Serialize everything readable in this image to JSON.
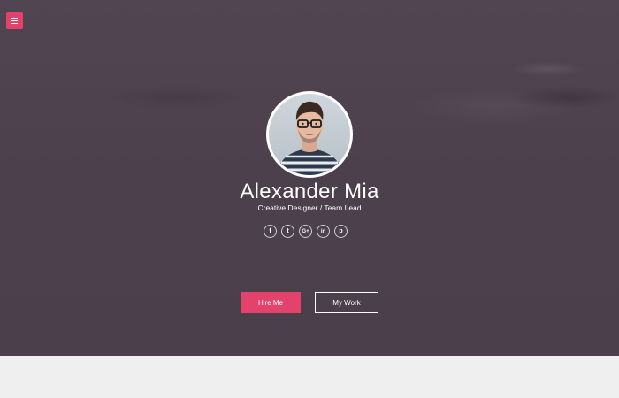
{
  "colors": {
    "accent": "#e3436a",
    "hero_bg": "#4c404c",
    "section_bg": "#efefef"
  },
  "menu": {
    "icon": "hamburger-menu-icon"
  },
  "profile": {
    "name": "Alexander Mia",
    "title": "Creative Designer / Team Lead",
    "avatar": "profile-photo"
  },
  "socials": [
    {
      "icon": "facebook-icon",
      "glyph": "f"
    },
    {
      "icon": "twitter-icon",
      "glyph": "t"
    },
    {
      "icon": "google-plus-icon",
      "glyph": "G+"
    },
    {
      "icon": "linkedin-icon",
      "glyph": "in"
    },
    {
      "icon": "pinterest-icon",
      "glyph": "p"
    }
  ],
  "buttons": {
    "hire_label": "Hire Me",
    "work_label": "My Work"
  }
}
